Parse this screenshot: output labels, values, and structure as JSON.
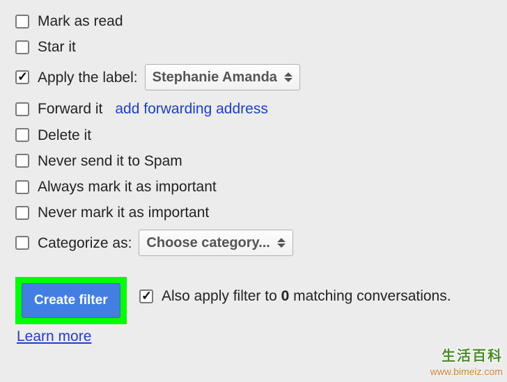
{
  "options": {
    "mark_as_read": {
      "label": "Mark as read",
      "checked": false
    },
    "star_it": {
      "label": "Star it",
      "checked": false
    },
    "apply_label": {
      "label": "Apply the label:",
      "checked": true,
      "dropdown": "Stephanie Amanda"
    },
    "forward_it": {
      "label": "Forward it",
      "checked": false,
      "link": "add forwarding address"
    },
    "delete_it": {
      "label": "Delete it",
      "checked": false
    },
    "never_spam": {
      "label": "Never send it to Spam",
      "checked": false
    },
    "always_important": {
      "label": "Always mark it as important",
      "checked": false
    },
    "never_important": {
      "label": "Never mark it as important",
      "checked": false
    },
    "categorize_as": {
      "label": "Categorize as:",
      "checked": false,
      "dropdown": "Choose category..."
    }
  },
  "footer": {
    "create_button": "Create filter",
    "also_apply_prefix": "Also apply filter to ",
    "also_apply_count": "0",
    "also_apply_suffix": " matching conversations.",
    "also_apply_checked": true,
    "learn_more": "Learn more"
  },
  "watermark": {
    "line1": "生活百科",
    "line2": "www.bimeiz.com"
  }
}
